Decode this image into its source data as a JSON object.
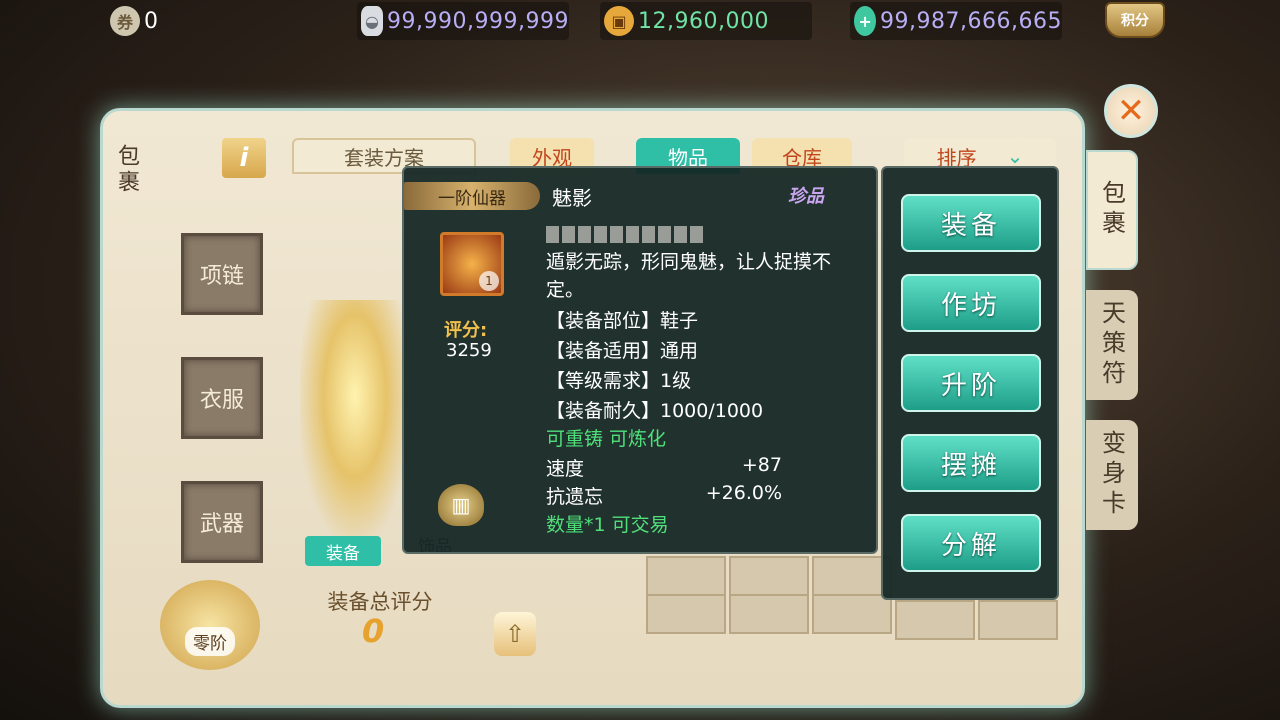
{
  "currencies": {
    "voucher": "0",
    "silver": "99,990,999,999",
    "coin": "12,960,000",
    "jade": "99,987,666,665"
  },
  "score_badge": "积分",
  "panel": {
    "left_title": "包裹",
    "set_plan": "套装方案",
    "tabs": {
      "appearance": "外观",
      "items": "物品",
      "warehouse": "仓库",
      "sort": "排序"
    }
  },
  "slots": {
    "necklace": "项链",
    "clothes": "衣服",
    "weapon": "武器"
  },
  "sub_tabs": {
    "equipment": "装备",
    "accessory": "饰品"
  },
  "rating": {
    "label": "装备总评分",
    "value": "0",
    "tier": "零阶"
  },
  "tooltip": {
    "tier": "一阶仙器",
    "name": "魅影",
    "rarity": "珍品",
    "level_badge": "1",
    "score_label": "评分:",
    "score_value": "3259",
    "description": "遁影无踪，形同鬼魅，让人捉摸不定。",
    "part": "【装备部位】鞋子",
    "usage": "【装备适用】通用",
    "level_req": "【等级需求】1级",
    "durability": "【装备耐久】1000/1000",
    "recast": "可重铸 可炼化",
    "stats": [
      {
        "name": "速度",
        "value": "+87"
      },
      {
        "name": "抗遗忘",
        "value": "+26.0%"
      }
    ],
    "quantity": "数量*1 可交易"
  },
  "actions": [
    "装备",
    "作坊",
    "升阶",
    "摆摊",
    "分解"
  ],
  "right_tabs": {
    "bag": "包裹",
    "talisman": "天策符",
    "transform": "变身卡"
  },
  "colors": {
    "accent": "#2fbfa6",
    "gold": "#e7a22d",
    "green_text": "#4fe07a",
    "rarity": "#caa6f0"
  }
}
